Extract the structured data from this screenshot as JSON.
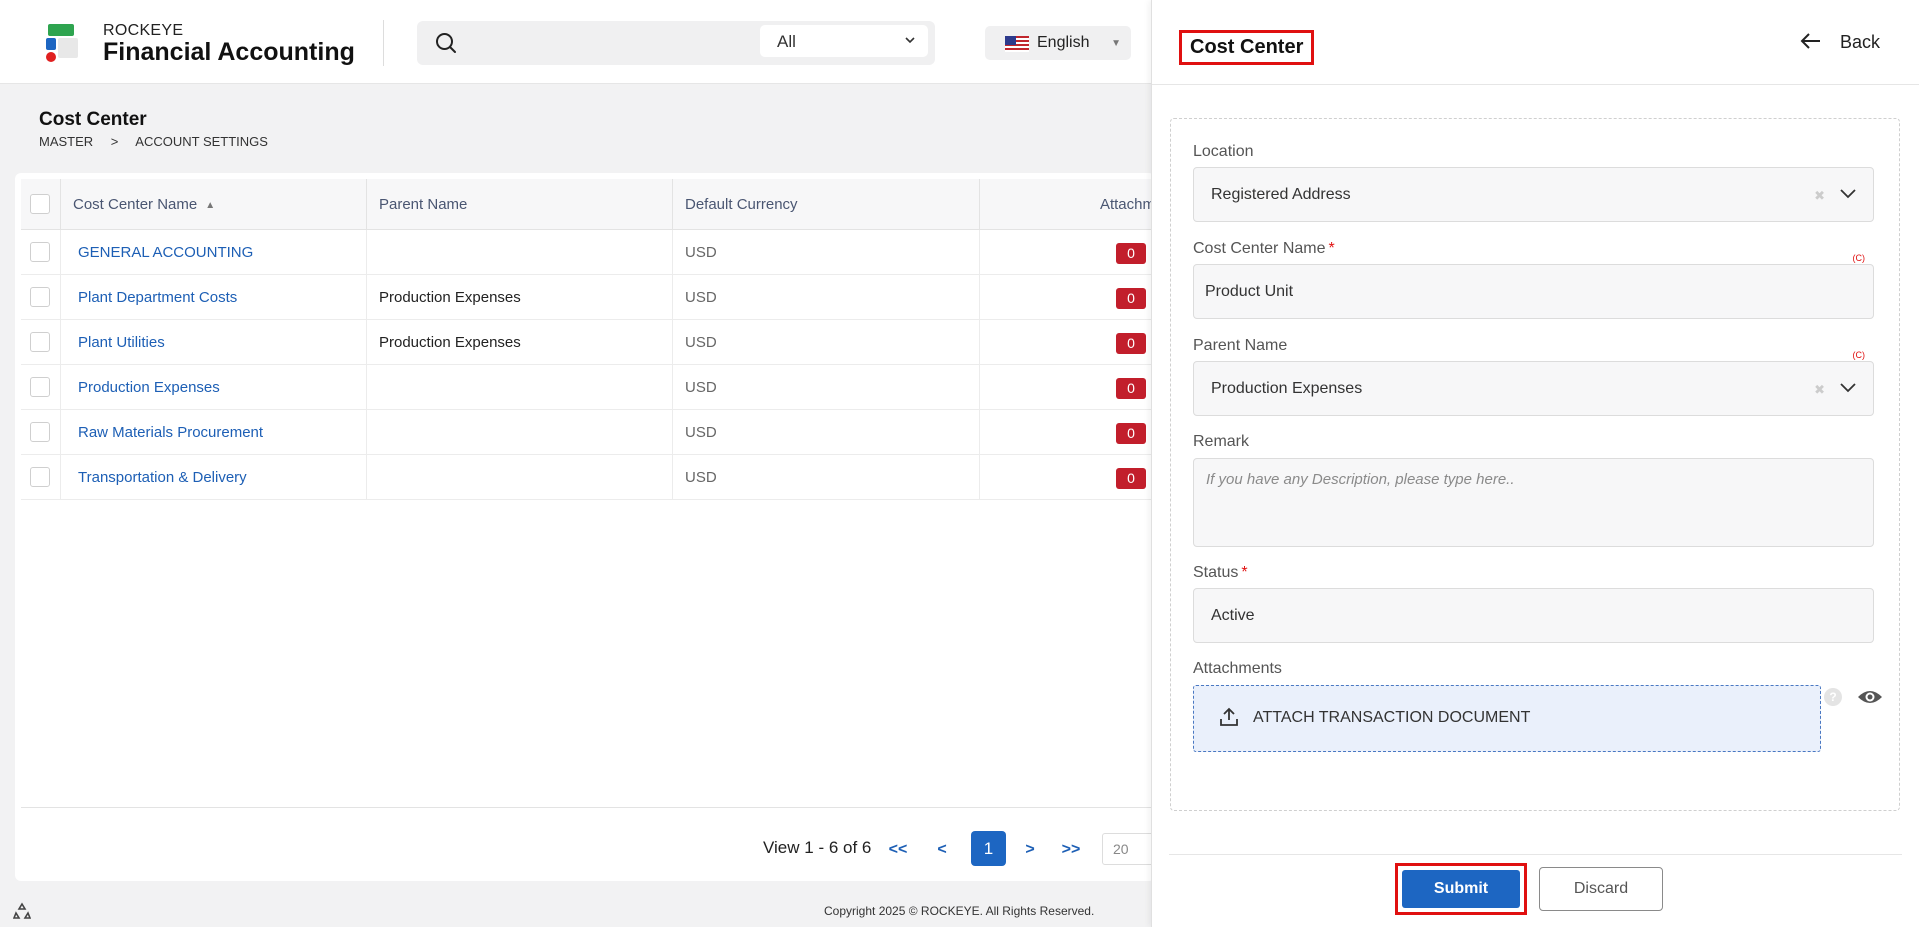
{
  "app": {
    "brand_small": "ROCKEYE",
    "brand_big": "Financial Accounting"
  },
  "header": {
    "search_placeholder": "",
    "scope_value": "All",
    "language": "English"
  },
  "page": {
    "title": "Cost Center",
    "breadcrumb": [
      "MASTER",
      ">",
      "ACCOUNT SETTINGS"
    ]
  },
  "table": {
    "columns": [
      "Cost Center Name",
      "Parent Name",
      "Default Currency",
      "Attachm"
    ],
    "rows": [
      {
        "name": "GENERAL ACCOUNTING",
        "parent": "",
        "currency": "USD",
        "attachments": "0"
      },
      {
        "name": "Plant Department Costs",
        "parent": "Production Expenses",
        "currency": "USD",
        "attachments": "0"
      },
      {
        "name": "Plant Utilities",
        "parent": "Production Expenses",
        "currency": "USD",
        "attachments": "0"
      },
      {
        "name": "Production Expenses",
        "parent": "",
        "currency": "USD",
        "attachments": "0"
      },
      {
        "name": "Raw Materials Procurement",
        "parent": "",
        "currency": "USD",
        "attachments": "0"
      },
      {
        "name": "Transportation & Delivery",
        "parent": "",
        "currency": "USD",
        "attachments": "0"
      }
    ]
  },
  "pager": {
    "info": "View 1 - 6 of 6",
    "first": "<<",
    "prev": "<",
    "current": "1",
    "next": ">",
    "last": ">>",
    "page_size": "20"
  },
  "footer": {
    "copyright": "Copyright 2025 © ROCKEYE. All Rights Reserved."
  },
  "panel": {
    "title": "Cost Center",
    "back_label": "Back",
    "location_label": "Location",
    "location_value": "Registered Address",
    "name_label": "Cost Center Name",
    "name_value": "Product Unit",
    "c_flag": "(C)",
    "parent_label": "Parent Name",
    "parent_value": "Production Expenses",
    "remark_label": "Remark",
    "remark_placeholder": "If you have any Description, please type here..",
    "status_label": "Status",
    "status_value": "Active",
    "attachments_label": "Attachments",
    "attach_label": "ATTACH TRANSACTION DOCUMENT",
    "required_mark": "*",
    "help_mark": "?",
    "submit_label": "Submit",
    "discard_label": "Discard"
  },
  "colors": {
    "primary": "#1d66c2",
    "link": "#1d5fb5",
    "badge": "#c21e2b",
    "highlight": "#e01010"
  }
}
